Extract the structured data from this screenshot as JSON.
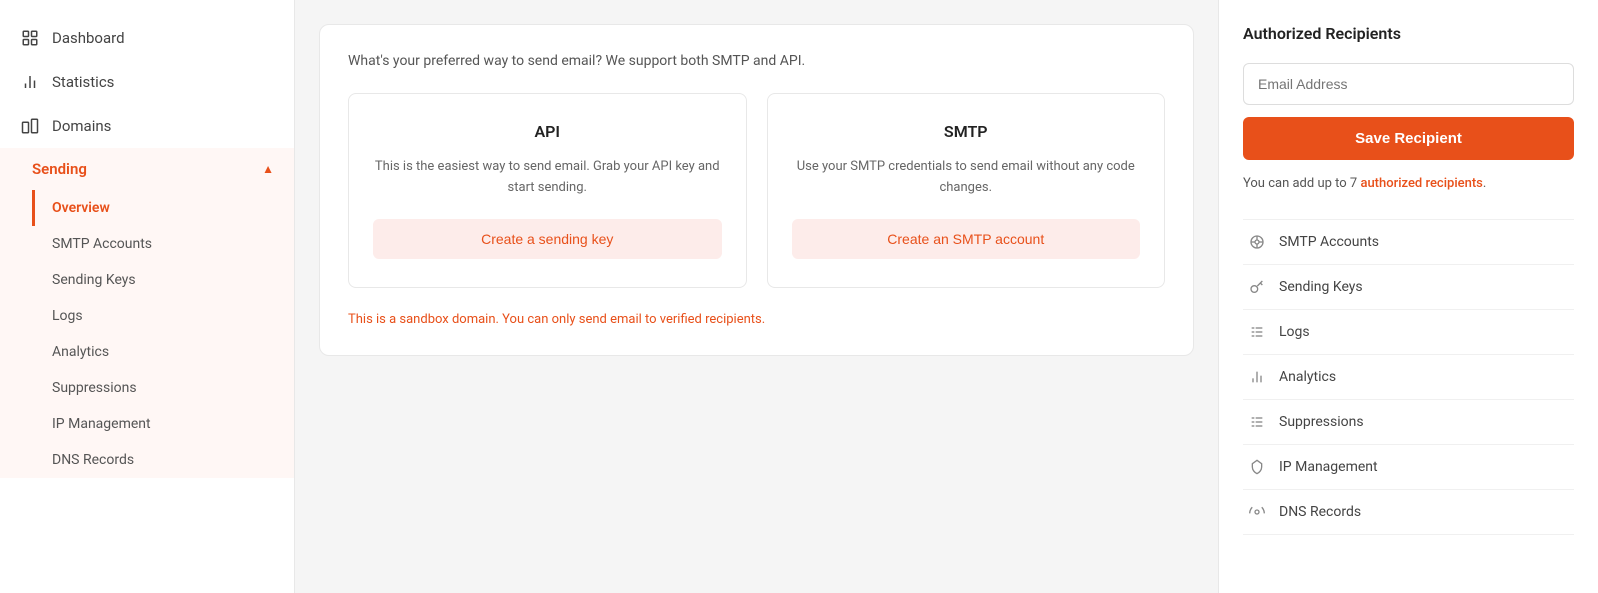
{
  "sidebar": {
    "items": [
      {
        "id": "dashboard",
        "label": "Dashboard"
      },
      {
        "id": "statistics",
        "label": "Statistics"
      },
      {
        "id": "domains",
        "label": "Domains"
      }
    ],
    "sending": {
      "label": "Sending",
      "sub_items": [
        {
          "id": "overview",
          "label": "Overview",
          "active": true
        },
        {
          "id": "smtp-accounts",
          "label": "SMTP Accounts"
        },
        {
          "id": "sending-keys",
          "label": "Sending Keys"
        },
        {
          "id": "logs",
          "label": "Logs"
        },
        {
          "id": "analytics",
          "label": "Analytics"
        },
        {
          "id": "suppressions",
          "label": "Suppressions"
        },
        {
          "id": "ip-management",
          "label": "IP Management"
        },
        {
          "id": "dns-records",
          "label": "DNS Records"
        }
      ]
    }
  },
  "main": {
    "subtitle": "What's your preferred way to send email? We support both SMTP and API.",
    "api_option": {
      "title": "API",
      "description": "This is the easiest way to send email. Grab your API key and start sending.",
      "button_label": "Create a sending key"
    },
    "smtp_option": {
      "title": "SMTP",
      "description": "Use your SMTP credentials to send email without any code changes.",
      "button_label": "Create an SMTP account"
    },
    "sandbox_notice": "This is a sandbox domain. You can only send email to verified recipients."
  },
  "right_panel": {
    "title": "Authorized Recipients",
    "email_placeholder": "Email Address",
    "save_button": "Save Recipient",
    "recipient_note_prefix": "You can add up to 7 ",
    "recipient_note_link": "authorized recipients",
    "recipient_note_suffix": ".",
    "nav_items": [
      {
        "id": "smtp-accounts",
        "label": "SMTP Accounts"
      },
      {
        "id": "sending-keys",
        "label": "Sending Keys"
      },
      {
        "id": "logs",
        "label": "Logs"
      },
      {
        "id": "analytics",
        "label": "Analytics"
      },
      {
        "id": "suppressions",
        "label": "Suppressions"
      },
      {
        "id": "ip-management",
        "label": "IP Management"
      },
      {
        "id": "dns-records",
        "label": "DNS Records"
      }
    ]
  },
  "colors": {
    "accent": "#e8501a",
    "accent_bg": "#fdecea"
  }
}
